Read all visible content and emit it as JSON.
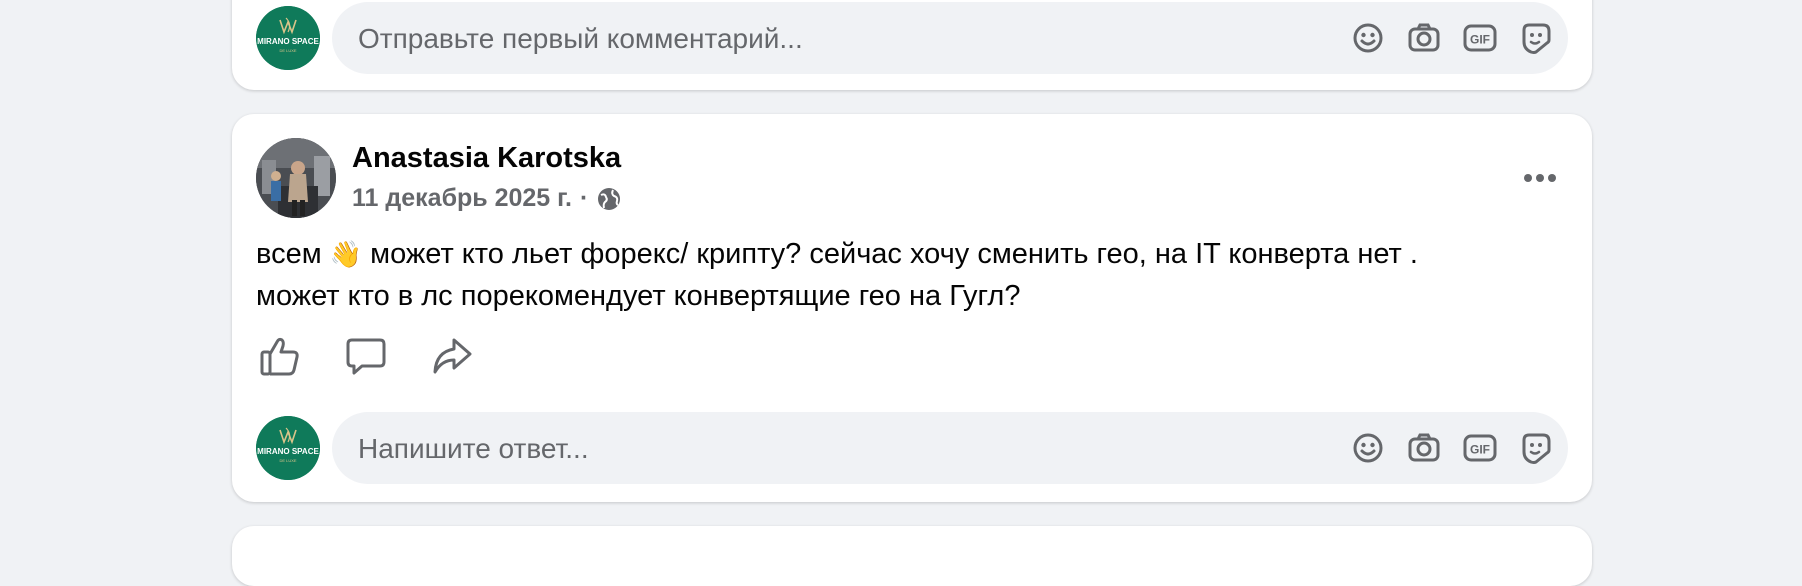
{
  "first_comment_bar": {
    "placeholder": "Отправьте первый комментарий..."
  },
  "post": {
    "author": "Anastasia Karotska",
    "date": "11 декабрь 2025 г.",
    "separator": "·",
    "text_line1_before_emoji": "всем ",
    "emoji": "👋",
    "text_line1_after_emoji": " может кто льет форекс/ крипту? сейчас хочу сменить гео, на IT конверта нет .",
    "text_line2": "может кто в лс порекомендует конвертящие гео на Гугл?"
  },
  "reply_bar": {
    "placeholder": "Напишите ответ..."
  },
  "brand": {
    "name": "MIRANO SPACE",
    "sub": "DE LUXE",
    "color": "#0f7a5a",
    "gold": "#d9c48a"
  },
  "composer_icons": [
    "emoji-icon",
    "camera-icon",
    "gif-icon",
    "sticker-icon"
  ]
}
